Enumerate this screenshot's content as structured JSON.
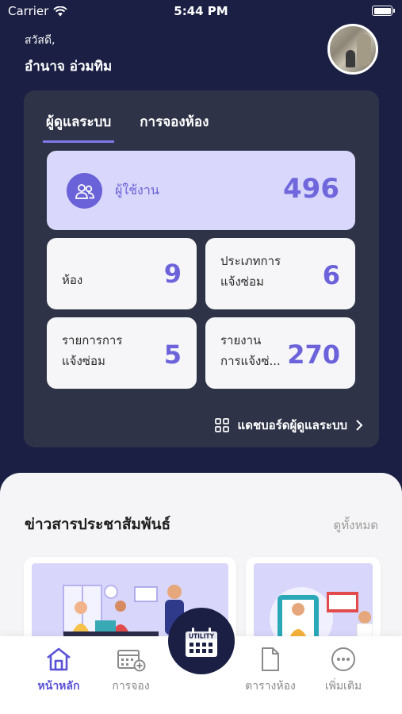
{
  "status_bar": {
    "carrier": "Carrier",
    "time": "5:44 PM"
  },
  "greeting": {
    "hello": "สวัสดี,",
    "name": "อำนาจ อ่วมทิม"
  },
  "admin": {
    "tabs": [
      {
        "label": "ผู้ดูแลระบบ",
        "active": true
      },
      {
        "label": "การจองห้อง",
        "active": false
      }
    ],
    "users": {
      "label": "ผู้ใช้งาน",
      "value": "496",
      "icon": "users-icon"
    },
    "stats": [
      {
        "label_line1": "ห้อง",
        "label_line2": "",
        "value": "9"
      },
      {
        "label_line1": "ประเภทการ",
        "label_line2": "แจ้งซ่อม",
        "value": "6"
      },
      {
        "label_line1": "รายการการ",
        "label_line2": "แจ้งซ่อม",
        "value": "5"
      },
      {
        "label_line1": "รายงาน",
        "label_line2": "การแจ้งซ่...",
        "value": "270"
      }
    ],
    "dashboard_link": "แดชบอร์ดผู้ดูแลระบบ"
  },
  "news": {
    "title": "ข่าวสารประชาสัมพันธ์",
    "see_all": "ดูทั้งหมด"
  },
  "bottom_nav": {
    "items": [
      {
        "label": "หน้าหลัก",
        "icon": "home-icon",
        "active": true
      },
      {
        "label": "การจอง",
        "icon": "calendar-add-icon",
        "active": false
      },
      {
        "label": "ตารางห้อง",
        "icon": "document-icon",
        "active": false
      },
      {
        "label": "เพิ่มเติม",
        "icon": "more-icon",
        "active": false
      }
    ],
    "fab_text": "UTILITY"
  },
  "colors": {
    "background": "#1b1f44",
    "accent": "#6c63db",
    "card": "#2f3347",
    "tile_highlight": "#d9d7fb"
  }
}
